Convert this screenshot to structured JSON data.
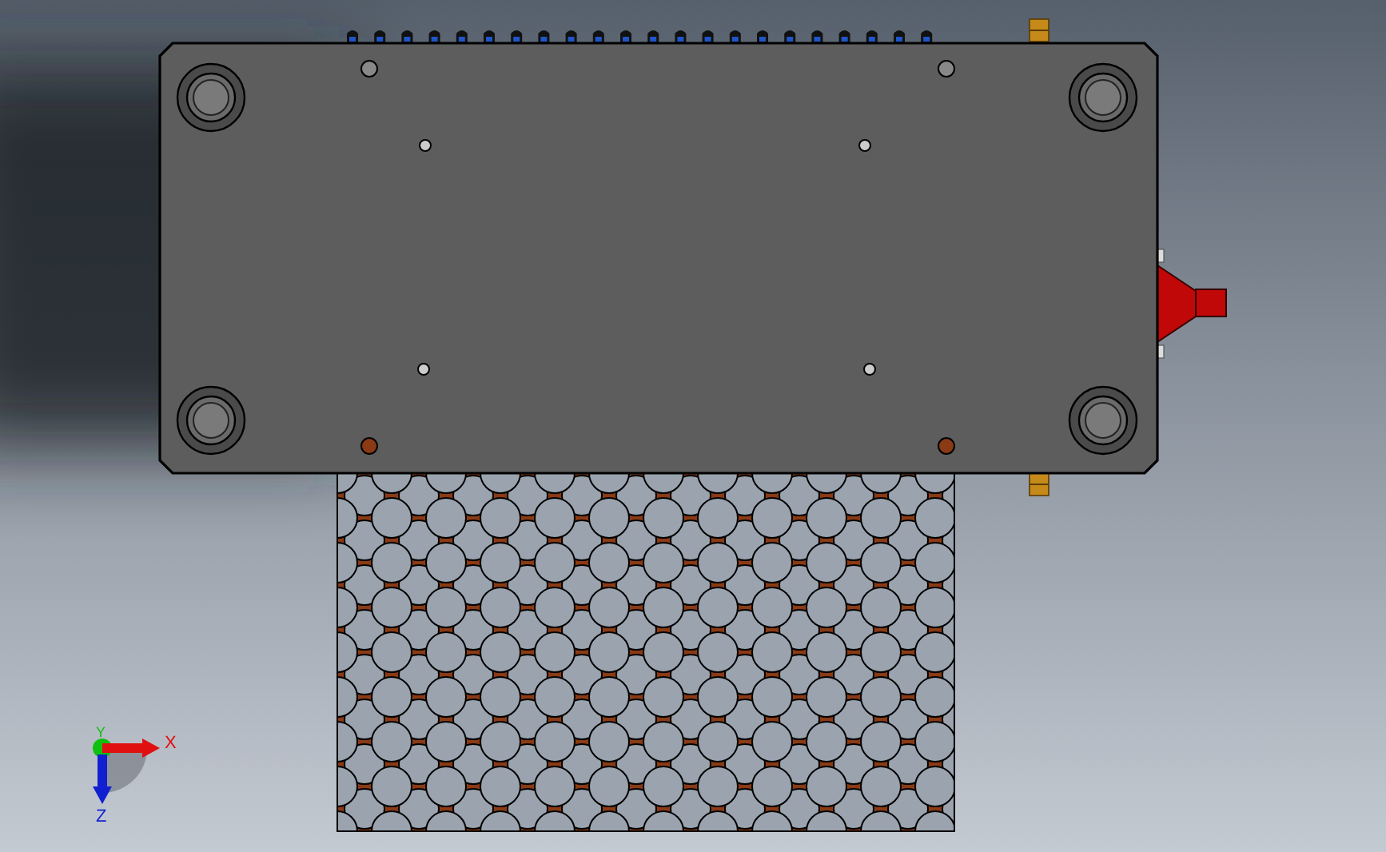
{
  "viewport": {
    "triad": [
      {
        "kind": "y",
        "label": "Y",
        "color": "#10c010"
      },
      {
        "kind": "x",
        "label": "X",
        "color": "#e01010"
      },
      {
        "kind": "z",
        "label": "Z",
        "color": "#1020d0"
      }
    ]
  }
}
